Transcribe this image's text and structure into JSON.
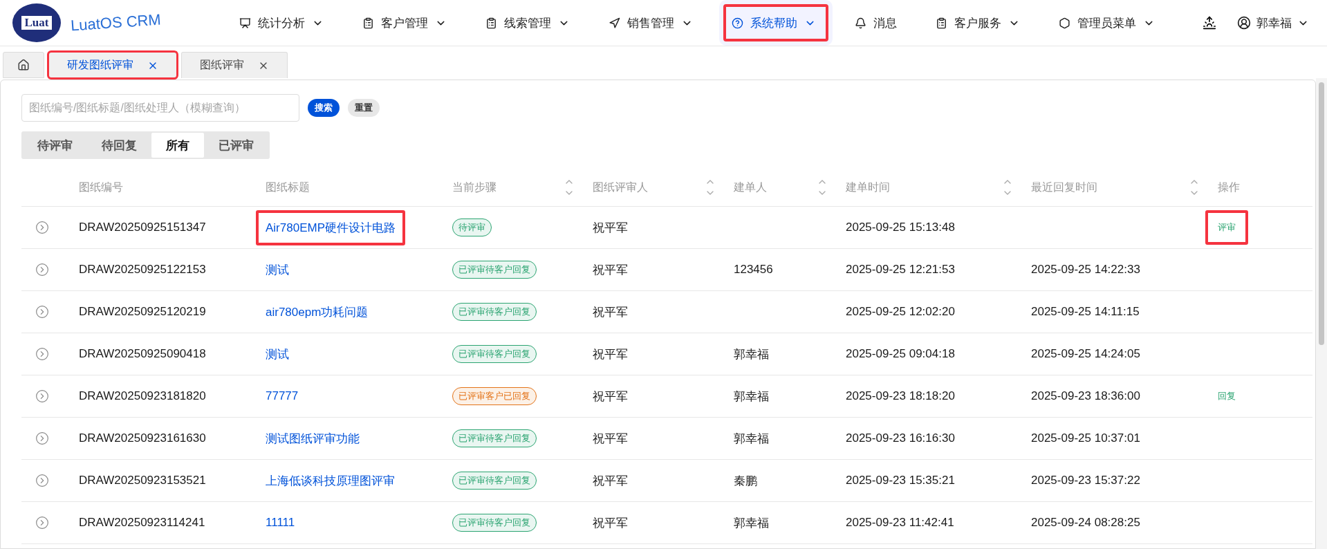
{
  "logo": {
    "mark": "Luat",
    "name": "LuatOS CRM"
  },
  "nav": [
    {
      "label": "统计分析",
      "dropdown": true,
      "selected": false,
      "highlighted": false
    },
    {
      "label": "客户管理",
      "dropdown": true,
      "selected": false,
      "highlighted": false
    },
    {
      "label": "线索管理",
      "dropdown": true,
      "selected": false,
      "highlighted": false
    },
    {
      "label": "销售管理",
      "dropdown": true,
      "selected": false,
      "highlighted": false
    },
    {
      "label": "系统帮助",
      "dropdown": true,
      "selected": true,
      "highlighted": true
    },
    {
      "label": "消息",
      "dropdown": false,
      "selected": false,
      "highlighted": false
    },
    {
      "label": "客户服务",
      "dropdown": true,
      "selected": false,
      "highlighted": false
    },
    {
      "label": "管理员菜单",
      "dropdown": true,
      "selected": false,
      "highlighted": false
    }
  ],
  "user": {
    "name": "郭幸福"
  },
  "page_tabs": [
    {
      "label": "研发图纸评审",
      "selected": true,
      "highlighted": true
    },
    {
      "label": "图纸评审",
      "selected": false,
      "highlighted": false
    }
  ],
  "search": {
    "placeholder": "图纸编号/图纸标题/图纸处理人（模糊查询）",
    "search_button": "搜索",
    "reset_button": "重置"
  },
  "filters": [
    {
      "label": "待评审",
      "selected": false
    },
    {
      "label": "待回复",
      "selected": false
    },
    {
      "label": "所有",
      "selected": true
    },
    {
      "label": "已评审",
      "selected": false
    }
  ],
  "table": {
    "columns": [
      {
        "label": "图纸编号",
        "sortable": false
      },
      {
        "label": "图纸标题",
        "sortable": false
      },
      {
        "label": "当前步骤",
        "sortable": true
      },
      {
        "label": "图纸评审人",
        "sortable": true
      },
      {
        "label": "建单人",
        "sortable": true
      },
      {
        "label": "建单时间",
        "sortable": true
      },
      {
        "label": "最近回复时间",
        "sortable": true
      },
      {
        "label": "操作",
        "sortable": false
      }
    ],
    "rows": [
      {
        "id": "DRAW20250925151347",
        "title": "Air780EMP硬件设计电路",
        "title_highlighted": true,
        "step": {
          "label": "待评审",
          "color": "#2ba471"
        },
        "reviewer": "祝平军",
        "created": "2025-09-25 15:13:48",
        "action": {
          "label": "评审",
          "highlighted": true
        }
      },
      {
        "id": "DRAW20250925122153",
        "title": "测试",
        "title_highlighted": false,
        "step": {
          "label": "已评审待客户回复",
          "color": "#2ba471"
        },
        "reviewer": "祝平军",
        "creator": "123456",
        "created": "2025-09-25 12:21:53",
        "replied": "2025-09-25 14:22:33"
      },
      {
        "id": "DRAW20250925120219",
        "title": "air780epm功耗问题",
        "title_highlighted": false,
        "step": {
          "label": "已评审待客户回复",
          "color": "#2ba471"
        },
        "reviewer": "祝平军",
        "created": "2025-09-25 12:02:20",
        "replied": "2025-09-25 14:11:15"
      },
      {
        "id": "DRAW20250925090418",
        "title": "测试",
        "title_highlighted": false,
        "step": {
          "label": "已评审待客户回复",
          "color": "#2ba471"
        },
        "reviewer": "祝平军",
        "creator": "郭幸福",
        "created": "2025-09-25 09:04:18",
        "replied": "2025-09-25 14:24:05"
      },
      {
        "id": "DRAW20250923181820",
        "title": "77777",
        "title_highlighted": false,
        "step": {
          "label": "已评审客户已回复",
          "color": "#e37318"
        },
        "reviewer": "祝平军",
        "creator": "郭幸福",
        "created": "2025-09-23 18:18:20",
        "replied": "2025-09-23 18:36:00",
        "action": {
          "label": "回复",
          "highlighted": false
        }
      },
      {
        "id": "DRAW20250923161630",
        "title": "测试图纸评审功能",
        "title_highlighted": false,
        "step": {
          "label": "已评审待客户回复",
          "color": "#2ba471"
        },
        "reviewer": "祝平军",
        "creator": "郭幸福",
        "created": "2025-09-23 16:16:30",
        "replied": "2025-09-25 10:37:01"
      },
      {
        "id": "DRAW20250923153521",
        "title": "上海低谈科技原理图评审",
        "title_highlighted": false,
        "step": {
          "label": "已评审待客户回复",
          "color": "#2ba471"
        },
        "reviewer": "祝平军",
        "creator": "秦鹏",
        "created": "2025-09-23 15:35:21",
        "replied": "2025-09-23 15:37:22"
      },
      {
        "id": "DRAW20250923114241",
        "title": "11111",
        "title_highlighted": false,
        "step": {
          "label": "已评审待客户回复",
          "color": "#2ba471"
        },
        "reviewer": "祝平军",
        "creator": "郭幸福",
        "created": "2025-09-23 11:42:41",
        "replied": "2025-09-24 08:28:25"
      }
    ]
  }
}
